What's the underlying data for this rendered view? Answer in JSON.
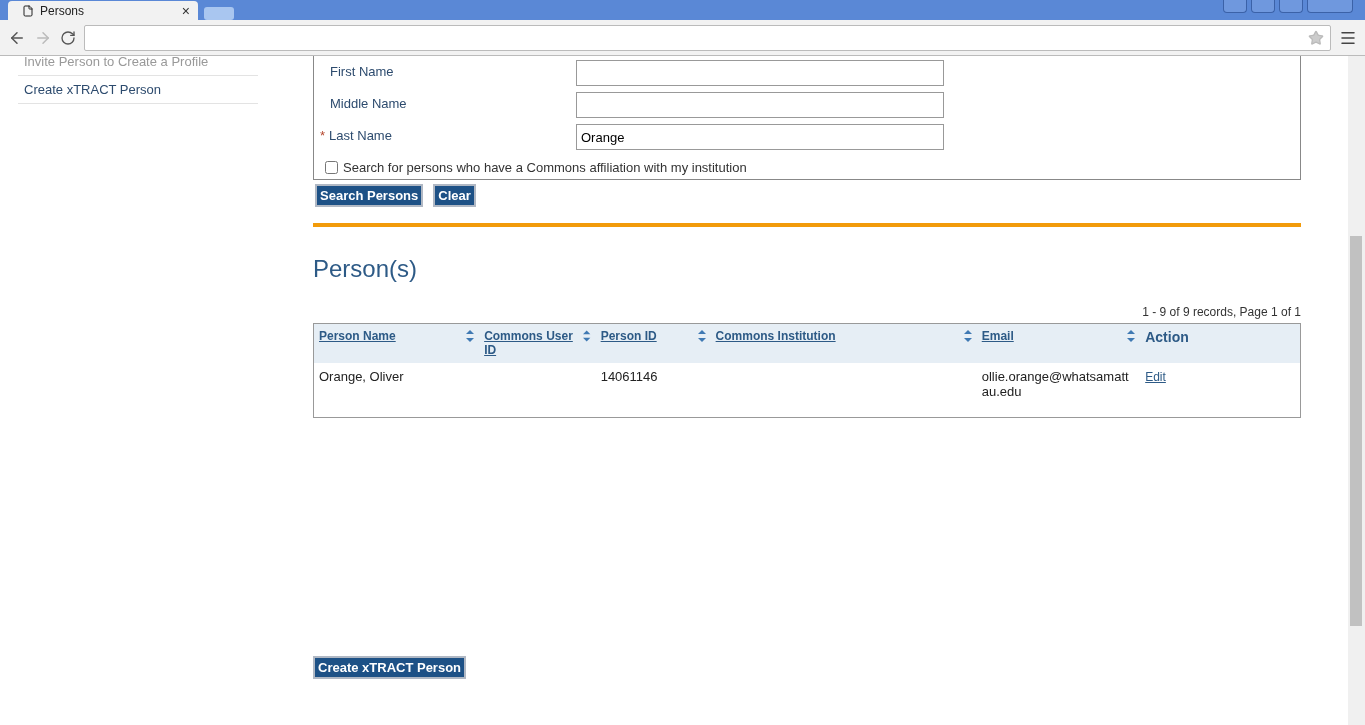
{
  "browser": {
    "tab_title": "Persons",
    "tab_close": "×"
  },
  "sidebar": {
    "items": [
      {
        "label": "Invite Person to Create a Profile",
        "disabled": true
      },
      {
        "label": "Create xTRACT Person",
        "disabled": false
      }
    ]
  },
  "search_form": {
    "fields": [
      {
        "label": "First Name",
        "required": false
      },
      {
        "label": "Middle Name",
        "required": false
      },
      {
        "label": "Last Name",
        "required": true,
        "required_mark": "*",
        "value": "Orange"
      }
    ],
    "affiliation_checkbox": {
      "label": "Search for persons who have a Commons affiliation with my institution",
      "checked": false
    },
    "buttons": [
      "Search Persons",
      "Clear"
    ]
  },
  "results": {
    "title": "Person(s)",
    "pager": "1 - 9 of 9 records, Page 1 of 1",
    "columns": [
      {
        "label": "Person Name",
        "sortable": true
      },
      {
        "label": "Commons User ID",
        "sortable": true
      },
      {
        "label": "Person ID",
        "sortable": true
      },
      {
        "label": "Commons Institution",
        "sortable": true
      },
      {
        "label": "Email",
        "sortable": true
      },
      {
        "label": "Action",
        "sortable": false
      }
    ],
    "rows": [
      {
        "cells": [
          "Orange, Oliver",
          "",
          "14061146",
          "",
          "ollie.orange@whatsamattau.edu"
        ],
        "action": "Edit"
      }
    ]
  },
  "footer_button": "Create xTRACT Person"
}
